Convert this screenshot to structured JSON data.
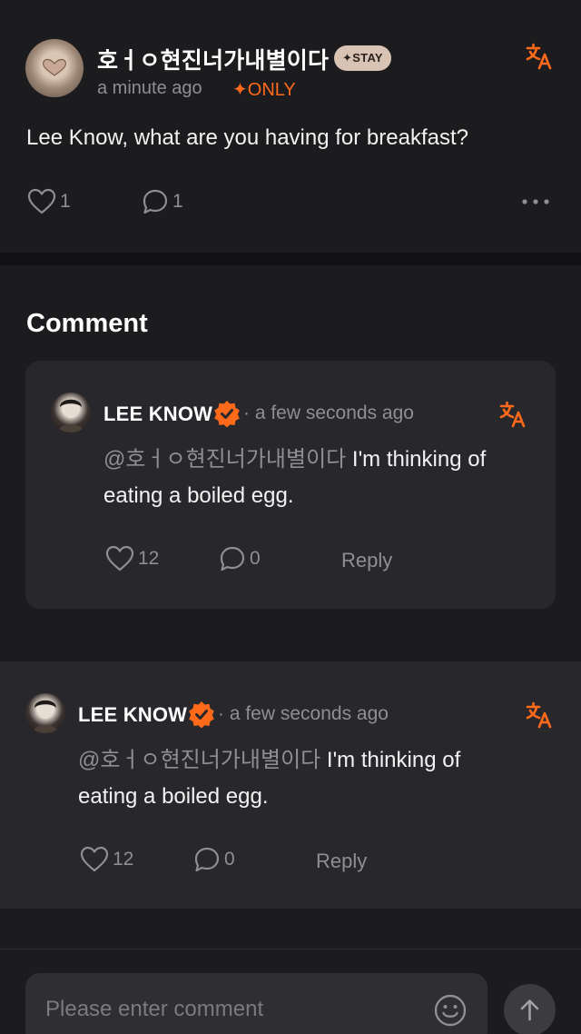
{
  "post": {
    "author": "호ㅓㅇ현진너가내별이다",
    "badge": "✦STAY",
    "time": "a minute ago",
    "only": "✦ONLY",
    "text": "Lee Know, what are you having for breakfast?",
    "likes": "1",
    "comments": "1"
  },
  "section": {
    "title": "Comment"
  },
  "comment1": {
    "author": "LEE KNOW",
    "time": "· a few seconds ago",
    "mention": "@호ㅓㅇ현진너가내별이다",
    "text": " I'm thinking of eating a boiled egg.",
    "likes": "12",
    "comments": "0",
    "reply": "Reply"
  },
  "comment2": {
    "author": "LEE KNOW",
    "time": "· a few seconds ago",
    "mention": "@호ㅓㅇ현진너가내별이다",
    "text": " I'm thinking of eating a boiled egg.",
    "likes": "12",
    "comments": "0",
    "reply": "Reply"
  },
  "composer": {
    "placeholder": "Please enter comment"
  },
  "colors": {
    "accent": "#ff6a1a",
    "muted": "#8e8e93",
    "card": "#28282c",
    "background": "#1c1c1f"
  },
  "icons": [
    "translate-icon",
    "heart-icon",
    "comment-icon",
    "more-icon",
    "verified-icon",
    "emoji-icon",
    "arrow-up-icon"
  ]
}
